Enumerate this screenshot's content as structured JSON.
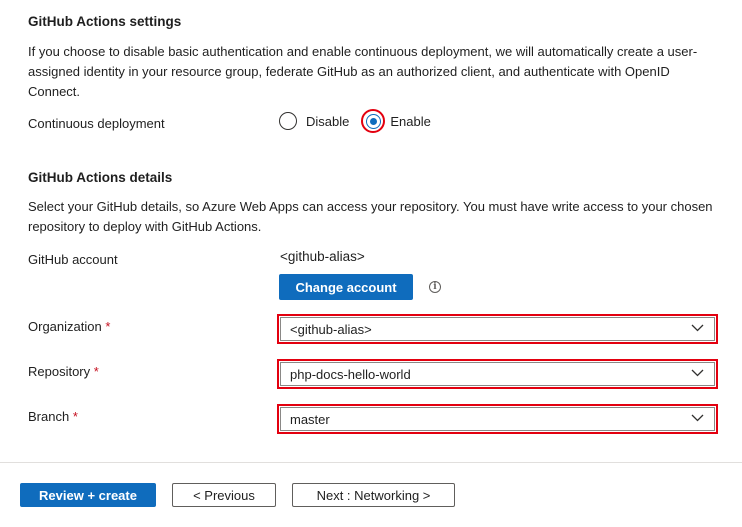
{
  "settings": {
    "title": "GitHub Actions settings",
    "description": "If you choose to disable basic authentication and enable continuous deployment, we will automatically create a user-assigned identity in your resource group, federate GitHub as an authorized client, and authenticate with OpenID Connect.",
    "cd_label": "Continuous deployment",
    "options": {
      "disable": "Disable",
      "enable": "Enable"
    },
    "selected": "Enable"
  },
  "details": {
    "title": "GitHub Actions details",
    "description": "Select your GitHub details, so Azure Web Apps can access your repository. You must have write access to your chosen repository to deploy with GitHub Actions.",
    "account_label": "GitHub account",
    "account_value": "<github-alias>",
    "change_account": "Change account",
    "info_icon": "i",
    "organization": {
      "label": "Organization",
      "required": "*",
      "value": "<github-alias>"
    },
    "repository": {
      "label": "Repository",
      "required": "*",
      "value": "php-docs-hello-world"
    },
    "branch": {
      "label": "Branch",
      "required": "*",
      "value": "master"
    }
  },
  "footer": {
    "review": "Review + create",
    "previous": "< Previous",
    "next": "Next : Networking >"
  },
  "colors": {
    "accent": "#0f6cbd",
    "highlight": "#e3000f",
    "required": "#c50f1f"
  },
  "icons": [
    "info-icon",
    "chevron-down-icon"
  ]
}
